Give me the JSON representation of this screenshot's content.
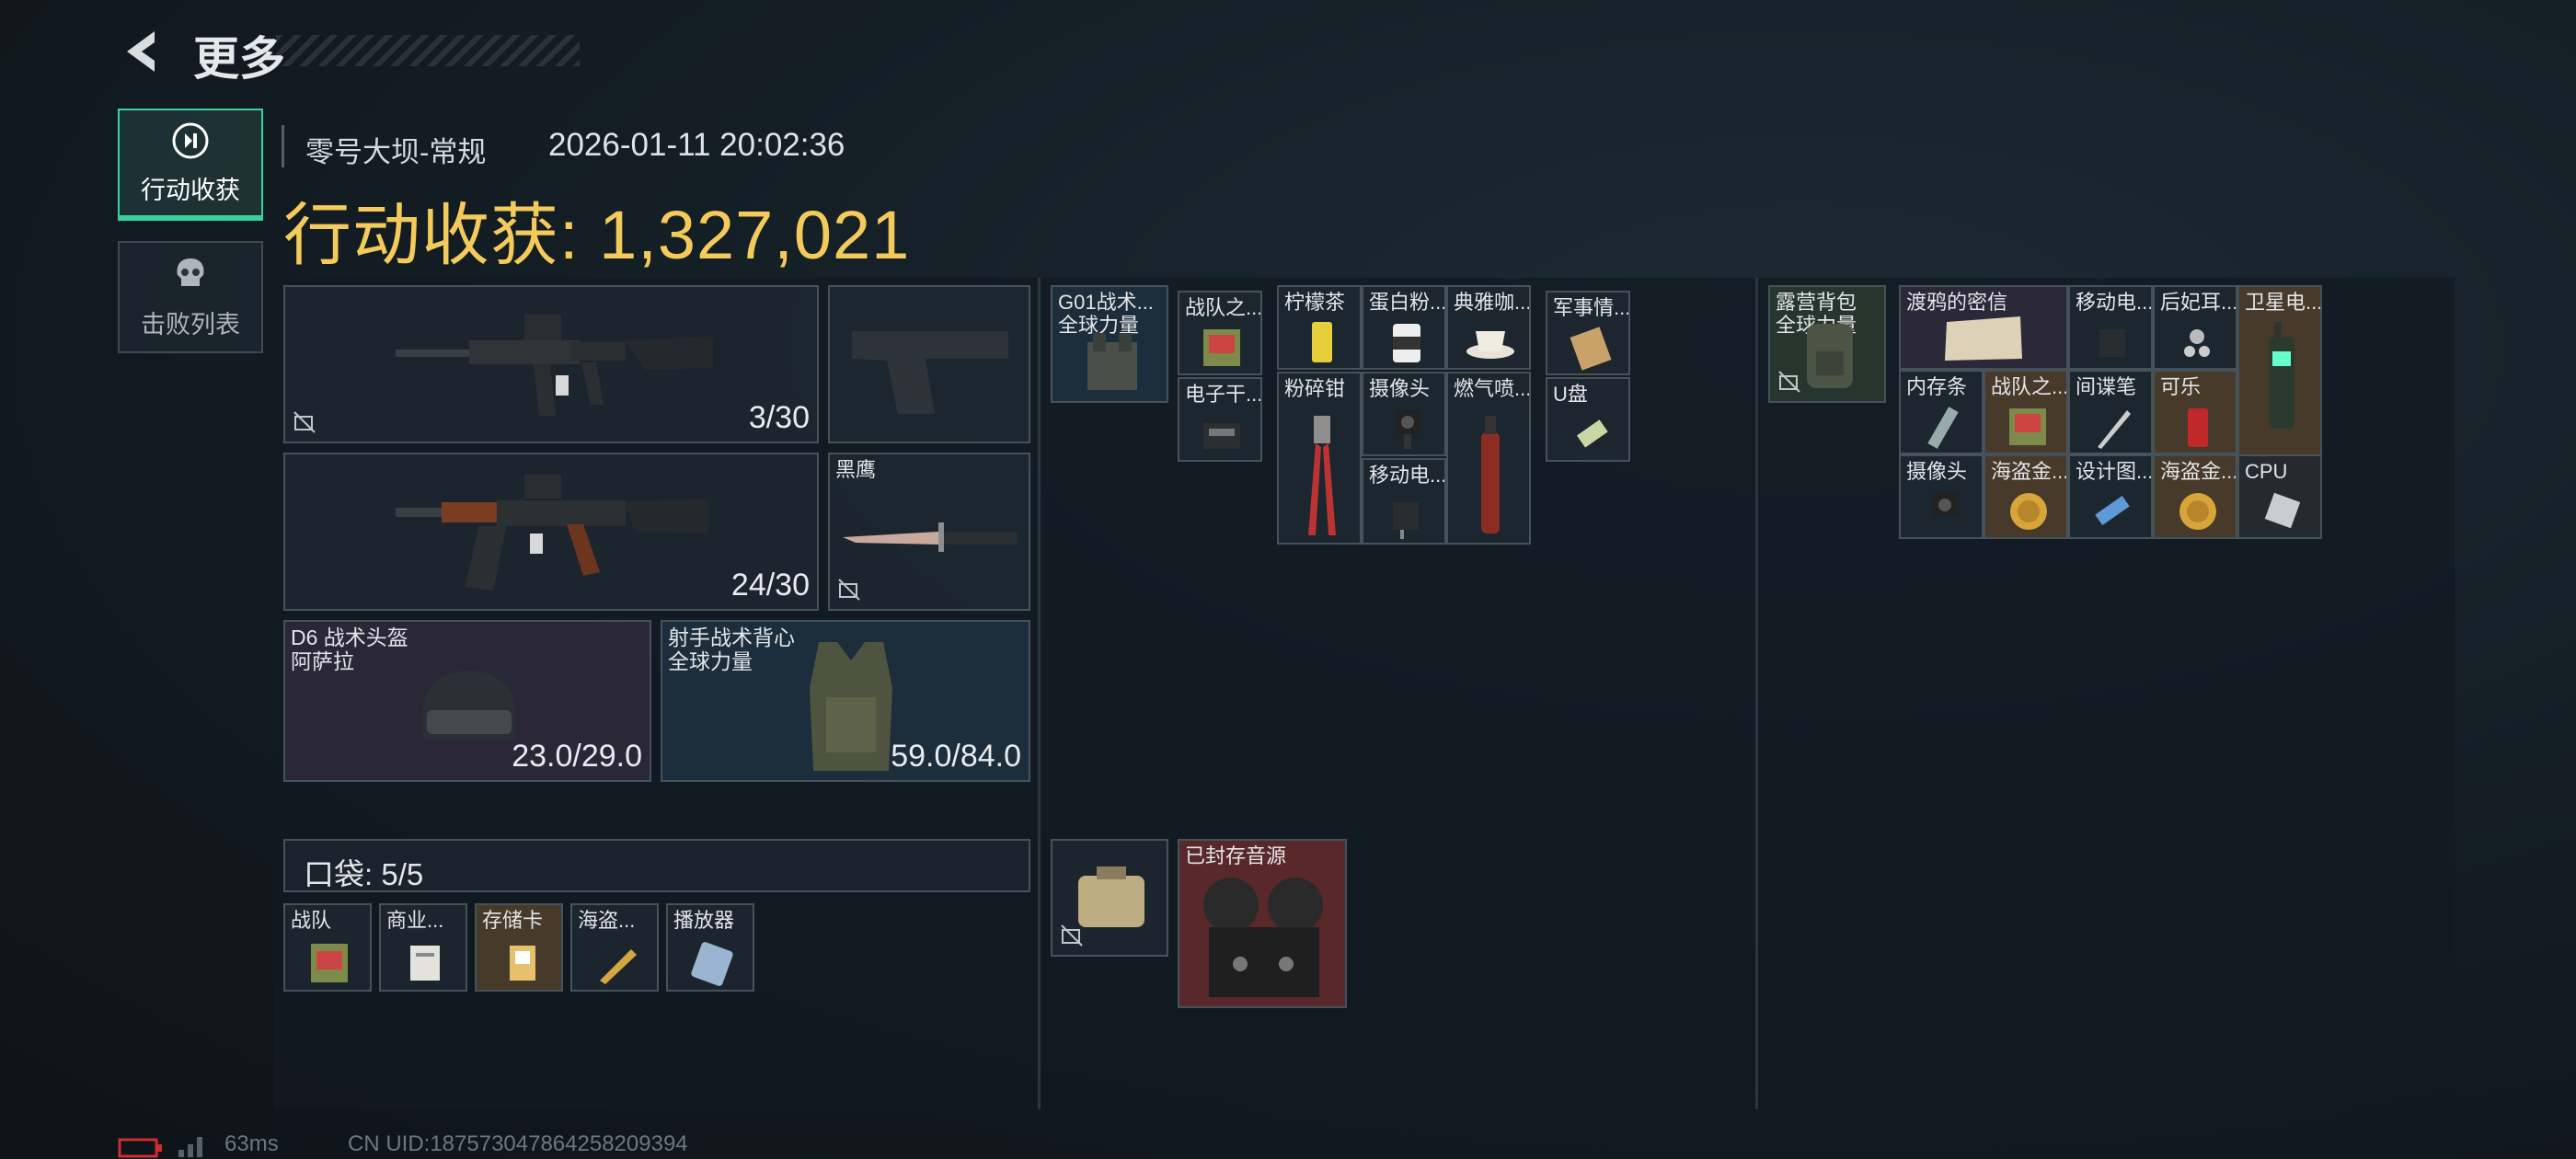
{
  "header": {
    "title": "更多"
  },
  "tabs": [
    {
      "label": "行动收获",
      "icon": "loot-target-icon",
      "active": true
    },
    {
      "label": "击败列表",
      "icon": "skull-icon",
      "active": false
    }
  ],
  "raid": {
    "map": "零号大坝-常规",
    "datetime": "2026-01-11 20:02:36",
    "total_label": "行动收获: 1,327,021"
  },
  "equipment": {
    "primary": {
      "ammo": "3/30",
      "icon": "assault-rifle-icon"
    },
    "secondary": {
      "ammo": "24/30",
      "icon": "ak-rifle-icon"
    },
    "pistol": {
      "icon": "pistol-silhouette-icon"
    },
    "melee": {
      "name": "黑鹰",
      "icon": "knife-icon"
    },
    "helmet": {
      "name": "D6 战术头盔\n阿萨拉",
      "durability": "23.0/29.0",
      "icon": "helmet-icon"
    },
    "armor": {
      "name": "射手战术背心\n全球力量",
      "durability": "59.0/84.0",
      "icon": "vest-icon"
    }
  },
  "pocket": {
    "label": "口袋: 5/5",
    "items": [
      "战队",
      "商业...",
      "存储卡",
      "海盗...",
      "播放器"
    ]
  },
  "chest_rig": {
    "name": "G01战术...\n全球力量",
    "items": [
      "战队之...",
      "柠檬茶",
      "蛋白粉...",
      "典雅咖...",
      "军事情...",
      "电子干...",
      "粉碎钳",
      "摄像头",
      "燃气喷...",
      "U盘",
      "移动电..."
    ]
  },
  "case": {
    "items": [
      "",
      "已封存音源"
    ]
  },
  "backpack": {
    "name": "露营背包\n全球力量",
    "items": [
      "渡鸦的密信",
      "移动电...",
      "后妃耳...",
      "卫星电...",
      "内存条",
      "战队之...",
      "间谍笔",
      "可乐",
      "摄像头",
      "海盗金...",
      "设计图...",
      "海盗金...",
      "CPU"
    ]
  },
  "status_bar": {
    "ping": "63ms",
    "uid": "CN UID:187573047864258209394"
  }
}
